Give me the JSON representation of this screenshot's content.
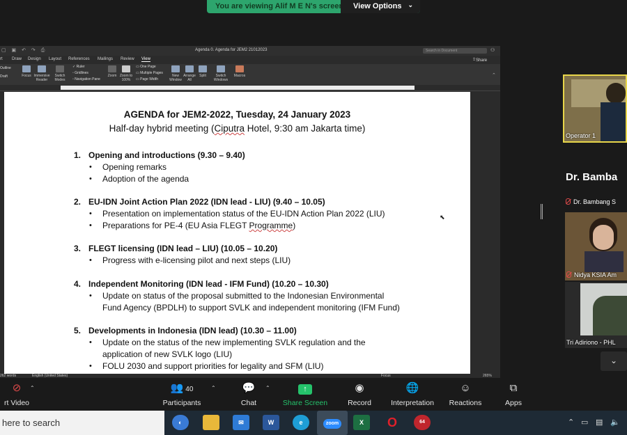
{
  "share_banner": {
    "text": "You are viewing Alif M E N's screen",
    "button": "View Options"
  },
  "word": {
    "doc_title": "Agenda 0. Agenda for JEM2 21012023",
    "search_placeholder": "Search in Document",
    "share": "Share",
    "tabs": [
      "rt",
      "Draw",
      "Design",
      "Layout",
      "References",
      "Mailings",
      "Review",
      "View"
    ],
    "ribbon": {
      "outline": "Outline",
      "draft": "Draft",
      "focus": "Focus",
      "immersive": "Immersive Reader",
      "switch_modes": "Switch Modes",
      "ruler": "Ruler",
      "gridlines": "Gridlines",
      "nav_pane": "Navigation Pane",
      "zoom": "Zoom",
      "zoom100": "Zoom to 100%",
      "one_page": "One Page",
      "multiple_pages": "Multiple Pages",
      "page_width": "Page Width",
      "new_window": "New Window",
      "arrange_all": "Arrange All",
      "split": "Split",
      "switch_windows": "Switch Windows",
      "macros": "Macros"
    },
    "status": {
      "words": "262 words",
      "language": "English (United States)",
      "focus": "Focus",
      "zoom": "265%"
    }
  },
  "document": {
    "title": "AGENDA for JEM2-2022, Tuesday, 24 January 2023",
    "subtitle_pre": "Half-day hybrid meeting (",
    "subtitle_link": "Ciputra",
    "subtitle_post": " Hotel, 9:30 am Jakarta time)",
    "items": [
      {
        "num": "1.",
        "head": "Opening and introductions (9.30 – 9.40)"
      },
      {
        "num": "2.",
        "head": "EU-IDN Joint Action Plan 2022 (IDN lead - LIU) (9.40 – 10.05)"
      },
      {
        "num": "3.",
        "head": "FLEGT licensing (IDN lead – LIU) (10.05 – 10.20)"
      },
      {
        "num": "4.",
        "head": "Independent Monitoring (IDN lead - IFM Fund) (10.20 – 10.30)"
      },
      {
        "num": "5.",
        "head": "Developments in Indonesia (IDN lead) (10.30 – 11.00)"
      }
    ],
    "bullets": {
      "b1a": "Opening remarks",
      "b1b": "Adoption of the agenda",
      "b2a": "Presentation on implementation status of the EU-IDN Action Plan 2022 (LIU)",
      "b2b_pre": "Preparations for PE-4 (EU Asia FLEGT ",
      "b2b_link": "Programme",
      "b2b_post": ")",
      "b3a": "Progress with e-licensing pilot and next steps (LIU)",
      "b4a_1": "Update on status of the proposal submitted to the Indonesian Environmental",
      "b4a_2": "Fund Agency (BPDLH) to support SVLK and independent monitoring (IFM Fund)",
      "b5a_1": "Update on the status of the new implementing SVLK regulation and the",
      "b5a_2": "application of new SVLK logo (LIU)",
      "b5b": "FOLU 2030 and support priorities for legality and SFM (LIU)"
    }
  },
  "participants_panel": {
    "tiles": [
      "Operator 1",
      "Dr. Bambang S",
      "Nidya KSIA Am",
      "Tri Adiriono - PHL"
    ],
    "speaker": "Dr. Bamba"
  },
  "toolbar": {
    "start_video": "rt Video",
    "participants": "Participants",
    "participants_count": "40",
    "chat": "Chat",
    "share_screen": "Share Screen",
    "record": "Record",
    "interpretation": "Interpretation",
    "reactions": "Reactions",
    "apps": "Apps"
  },
  "taskbar": {
    "search": "here to search",
    "zoom": "zoom",
    "badge": "64"
  }
}
